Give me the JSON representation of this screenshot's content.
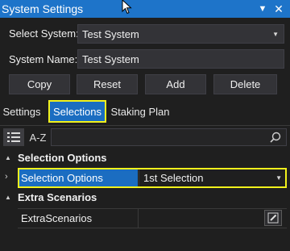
{
  "window": {
    "title": "System Settings",
    "pin_icon": "dropdown-triangle-icon",
    "close_icon": "close-icon"
  },
  "form": {
    "select_system_label": "Select System:",
    "select_system_value": "Test System",
    "system_name_label": "System Name:",
    "system_name_value": "Test System"
  },
  "buttons": {
    "copy": "Copy",
    "reset": "Reset",
    "add": "Add",
    "delete": "Delete"
  },
  "tabs": [
    {
      "label": "Settings",
      "active": false
    },
    {
      "label": "Selections",
      "active": true
    },
    {
      "label": "Staking Plan",
      "active": false
    }
  ],
  "toolbar": {
    "categorized_icon": "categorized-view-icon",
    "az_label": "A-Z",
    "search_value": "",
    "search_icon": "search-icon"
  },
  "grid": {
    "category1": "Selection Options",
    "row1_name": "Selection Options",
    "row1_value": "1st Selection",
    "category2": "Extra Scenarios",
    "row2_name": "ExtraScenarios",
    "row2_value": "",
    "edit_icon": "edit-pencil-icon"
  },
  "colors": {
    "accent": "#1b6dc1",
    "highlight_outline": "#f2f21c",
    "background": "#1f1f1f"
  }
}
